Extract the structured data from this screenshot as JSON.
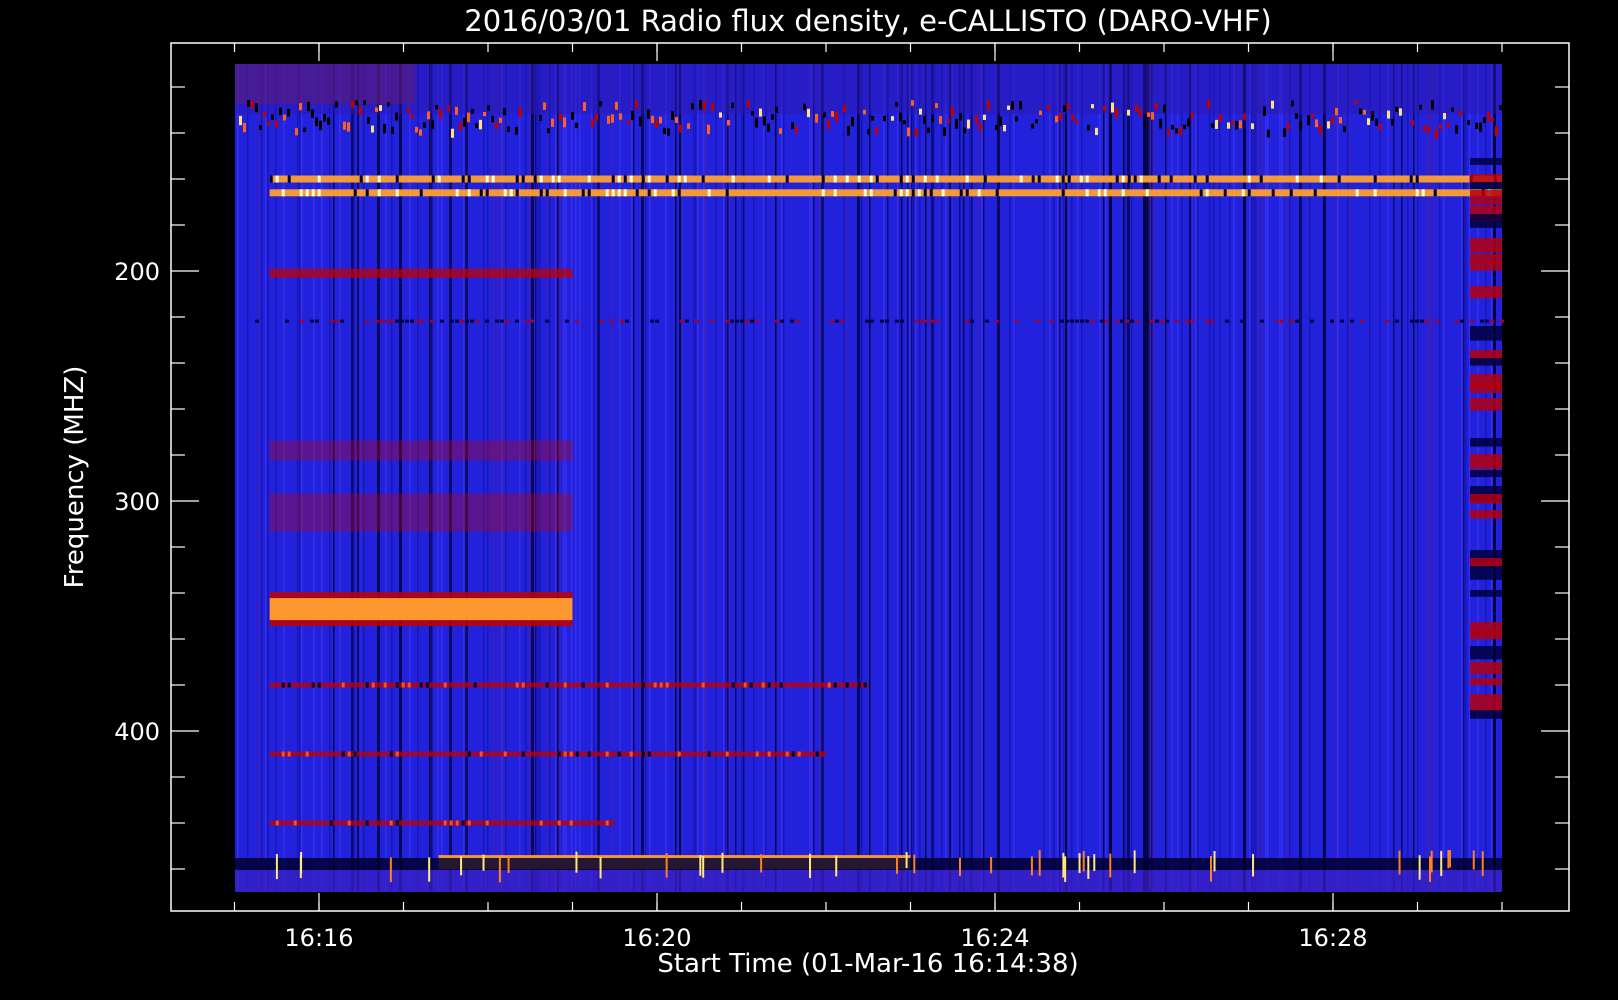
{
  "chart_data": {
    "type": "heatmap",
    "title": "2016/03/01  Radio flux density, e-CALLISTO (DARO-VHF)",
    "xlabel": "Start Time (01-Mar-16 16:14:38)",
    "ylabel": "Frequency (MHZ)",
    "x_unit": "time (HH:MM)",
    "xlim": [
      "16:14:38",
      "16:30:00"
    ],
    "x_ticks": [
      "16:16",
      "16:20",
      "16:24",
      "16:28"
    ],
    "y_unit": "MHz",
    "ylim": [
      470,
      110
    ],
    "y_inverted": true,
    "y_ticks": [
      200,
      300,
      400
    ],
    "grid": false,
    "colormap": {
      "background": "#2222dd",
      "low": "#000030",
      "mid": "#c00000",
      "high": "#ffa030",
      "peak": "#ffffd0"
    },
    "features": [
      {
        "freq": 160,
        "start": "16:15:25",
        "end": "16:30:00",
        "intensity": "high"
      },
      {
        "freq": 166,
        "start": "16:15:25",
        "end": "16:30:00",
        "intensity": "high"
      },
      {
        "freq": 201,
        "start": "16:15:25",
        "end": "16:19:00",
        "intensity": "mid"
      },
      {
        "freq": 278,
        "start": "16:15:25",
        "end": "16:19:00",
        "intensity": "mid"
      },
      {
        "freq": 305,
        "start": "16:15:25",
        "end": "16:19:00",
        "intensity": "mid"
      },
      {
        "freq": 347,
        "start": "16:15:25",
        "end": "16:19:00",
        "intensity": "high"
      },
      {
        "freq": 380,
        "start": "16:15:25",
        "end": "16:22:30",
        "intensity": "mid"
      },
      {
        "freq": 410,
        "start": "16:15:25",
        "end": "16:22:00",
        "intensity": "mid"
      },
      {
        "freq": 440,
        "start": "16:15:25",
        "end": "16:19:30",
        "intensity": "mid"
      },
      {
        "freq": 457,
        "start": "16:17:25",
        "end": "16:23:00",
        "intensity": "high"
      }
    ]
  }
}
